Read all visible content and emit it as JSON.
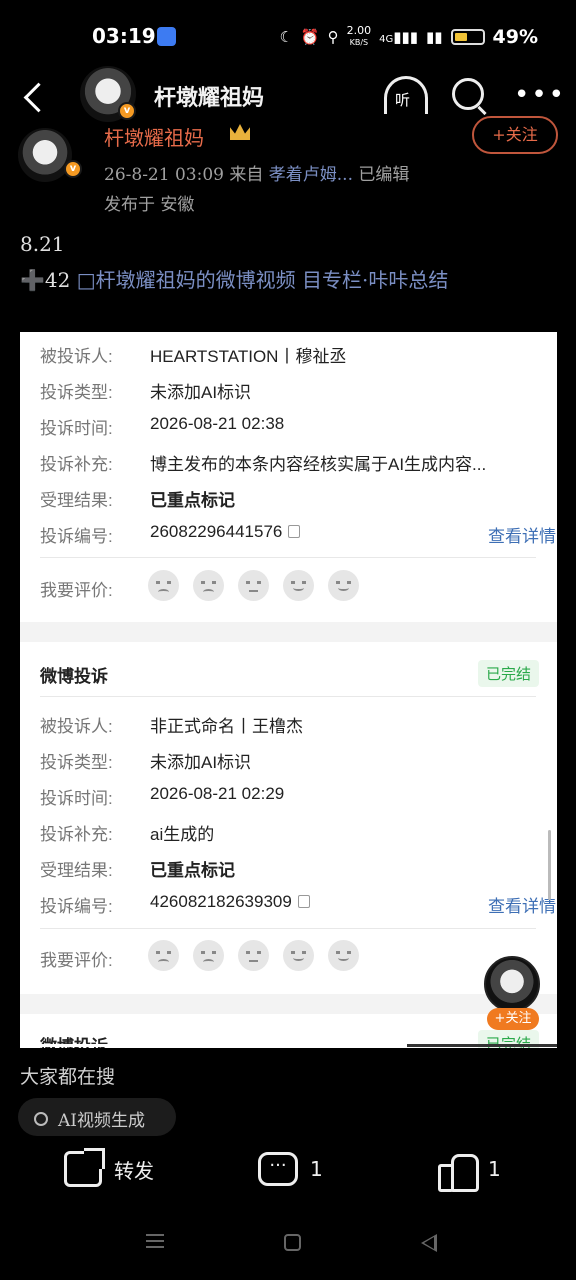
{
  "status_bar": {
    "time": "03:19",
    "net_speed_top": "2.00",
    "net_speed_unit": "KB/S",
    "net_type": "4G",
    "battery_level": 0.49,
    "battery_text": "49%"
  },
  "header": {
    "title": "杆墩耀祖妈",
    "listen_label": "听"
  },
  "post": {
    "author": "杆墩耀祖妈",
    "follow_label": "+关注",
    "date": "26-8-21 03:09",
    "from_prefix": "来自",
    "source": "孝着卢姆...",
    "edited": "已编辑",
    "location": "发布于 安徽",
    "line1": "8.21",
    "plus_count": "➕42",
    "video_link": "□杆墩耀祖妈的微博视频",
    "column_link": "目专栏·咔咔总结"
  },
  "complaints": {
    "labels": {
      "respondent": "被投诉人:",
      "type": "投诉类型:",
      "time": "投诉时间:",
      "supplement": "投诉补充:",
      "result": "受理结果:",
      "number": "投诉编号:",
      "rate": "我要评价:",
      "detail": "查看详情"
    },
    "items": [
      {
        "respondent": "HEARTSTATION丨穆祉丞",
        "type": "未添加AI标识",
        "time": "2026-08-21 02:38",
        "supplement": "博主发布的本条内容经核实属于AI生成内容...",
        "result": "已重点标记",
        "number": "26082296441576"
      },
      {
        "section_title": "微博投诉",
        "status": "已完结",
        "respondent": "非正式命名丨王橹杰",
        "type": "未添加AI标识",
        "time": "2026-08-21 02:29",
        "supplement": "ai生成的",
        "result": "已重点标记",
        "number": "426082182639309"
      },
      {
        "section_title": "微博投诉",
        "status": "已完结"
      }
    ]
  },
  "float_follow": {
    "label": "+关注"
  },
  "trending": {
    "title": "大家都在搜",
    "chip": "AI视频生成"
  },
  "actions": {
    "repost_label": "转发",
    "comment_count": "1",
    "like_count": "1"
  },
  "colors": {
    "accent": "#e76b4a",
    "link": "#7b8fc4",
    "done_green": "#2aa94a",
    "follow_orange": "#f07a20"
  }
}
